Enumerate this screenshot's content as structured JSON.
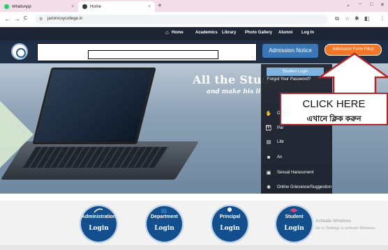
{
  "browser": {
    "tabs": [
      {
        "title": "WhatsApp",
        "close": "×",
        "favicon_color": "#25d366"
      },
      {
        "title": "Home",
        "close": "×",
        "favicon_color": "#3a3a3a"
      }
    ],
    "new_tab": "+",
    "window_controls": [
      "⌄",
      "−",
      "□",
      "✕"
    ],
    "nav": {
      "back": "←",
      "forward": "→",
      "reload": "C"
    },
    "url": "jaminicoycollege.in",
    "right_icons": [
      "⧉",
      "☆",
      "✱",
      "◧",
      "⋮"
    ]
  },
  "site_nav": {
    "home_icon": "house-icon",
    "items": [
      "Home",
      "Academics",
      "Library",
      "Photo Gallery",
      "Alumni",
      "Log In"
    ]
  },
  "header": {
    "admission_notice": "Admission Notice",
    "admission_form": "Admission Form Fillup"
  },
  "hero": {
    "title": "All the Stud",
    "subtitle": "and make his li"
  },
  "menu": {
    "student_login": "Student Login",
    "forgot": "Forgot Your Password?",
    "items": [
      {
        "label": "Onl",
        "icon": "hands-icon"
      },
      {
        "label": "Par",
        "icon": "people-icon"
      },
      {
        "label": "Libr",
        "icon": "book-icon"
      },
      {
        "label": "An",
        "icon": "ambulance-icon"
      },
      {
        "label": "Sexual Harassment",
        "icon": "alert-icon"
      },
      {
        "label": "Online Grievance/Suggestion",
        "icon": "lightbulb-icon"
      }
    ]
  },
  "callout": {
    "english": "CLICK HERE",
    "bengali": "এখানে ক্লিক করুন",
    "border_color": "#b3262c"
  },
  "logins": [
    {
      "top": "Administration",
      "bottom": "Login"
    },
    {
      "top": "Department",
      "bottom": "Login"
    },
    {
      "top": "Principal",
      "bottom": "Login"
    },
    {
      "top": "Student",
      "bottom": "Login"
    }
  ],
  "watermark": {
    "line1": "Activate Windows",
    "line2": "Go to Settings to activate Windows."
  },
  "colors": {
    "nav_bg": "#1d2433",
    "header_bg": "#1f2f46",
    "notice_btn": "#3a77b7",
    "fillup_btn": "#f0762a",
    "login_circle": "#134f8c"
  }
}
